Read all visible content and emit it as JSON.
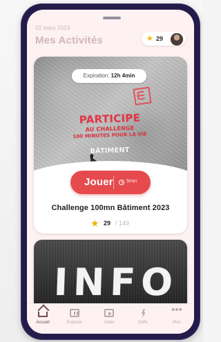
{
  "header": {
    "date": "22 mars 2023",
    "title": "Mes Activités",
    "score": "29",
    "star_icon": "star-icon",
    "avatar": "avatar"
  },
  "featured_card": {
    "expiration_label": "Expiration:",
    "expiration_value": "12h 4min",
    "poster": {
      "line1": "PARTICIPE",
      "line2": "AU CHALLENGE",
      "line3": "100 MINUTES POUR LA VIE",
      "line4": "BÂTIMENT"
    },
    "play_label": "Jouer",
    "duration": "5min",
    "title": "Challenge 100mn Bâtiment 2023",
    "rating_current": "29",
    "rating_total": "/ 149"
  },
  "secondary_card": {
    "word": "INFO"
  },
  "bottom_nav": [
    {
      "label": "Accueil",
      "icon": "home-icon",
      "active": true
    },
    {
      "label": "Explorer",
      "icon": "explore-icon",
      "active": false
    },
    {
      "label": "Vidéo",
      "icon": "video-icon",
      "active": false
    },
    {
      "label": "Défis",
      "icon": "bolt-icon",
      "active": false
    },
    {
      "label": "Plus",
      "icon": "more-icon",
      "active": false
    }
  ],
  "colors": {
    "phone_frame": "#231c4a",
    "screen_bg": "#fdf1f2",
    "accent_red": "#e64a4d",
    "gold_star": "#f1b400"
  }
}
